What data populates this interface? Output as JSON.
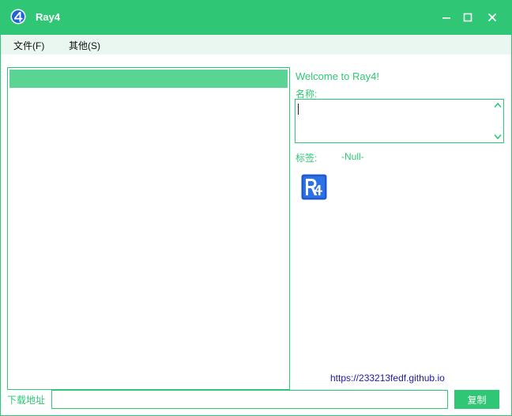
{
  "window": {
    "title": "Ray4",
    "accent_color": "#2fc775",
    "icons": {
      "app": "ray4-app-icon",
      "minimize": "minimize-icon",
      "maximize": "maximize-icon",
      "close": "close-icon"
    }
  },
  "menu": {
    "file_label": "文件(F)",
    "other_label": "其他(S)"
  },
  "panel": {
    "welcome": "Welcome to Ray4!",
    "name_label": "名称:",
    "name_value": "",
    "tag_label": "标签:",
    "tag_value": "-Null-",
    "logo_icon": "ray4-logo-icon"
  },
  "footer": {
    "link": "https://233213fedf.github.io",
    "download_label": "下载地址",
    "download_value": "",
    "copy_label": "复制"
  }
}
